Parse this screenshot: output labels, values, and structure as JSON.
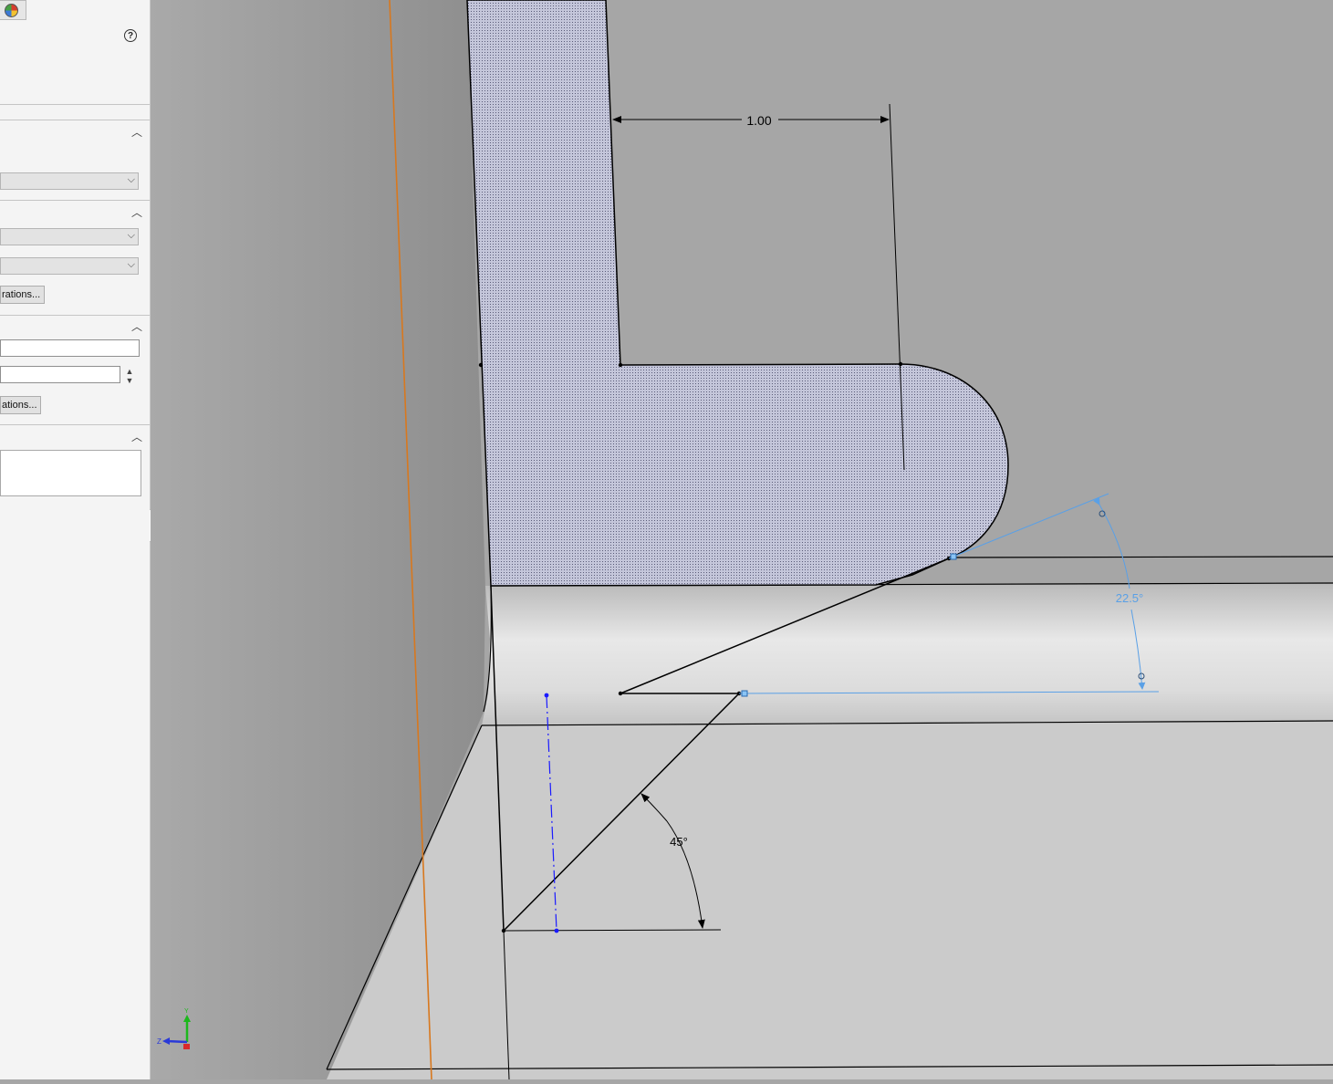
{
  "property_manager": {
    "help_glyph": "?",
    "groups": [
      {
        "collapse_icon": "chevron-up-icon",
        "combo_value": ""
      },
      {
        "collapse_icon": "chevron-up-icon",
        "combo1_value": "",
        "combo2_value": "",
        "button_label": "rations..."
      },
      {
        "collapse_icon": "chevron-up-icon",
        "field1_value": "",
        "field2_value": "",
        "button_label": "ations..."
      },
      {
        "collapse_icon": "chevron-up-icon",
        "list_value": ""
      }
    ],
    "splitter_glyph": "◦"
  },
  "viewport": {
    "dimensions": {
      "horizontal_distance": "1.00",
      "bottom_angle": "45°",
      "driven_angle": "22.5°"
    },
    "triad": {
      "y_axis": "Y",
      "z_axis": "Z"
    },
    "colors": {
      "background": "#a6a6a6",
      "wall_face": "#999999",
      "floor_face": "#cbcbcb",
      "sketch_region": "#b4b6cc",
      "sketch_line": "#000000",
      "driven_dimension": "#5aa0e6",
      "construction_line": "#1a1aff",
      "origin_axis": "#e07a20"
    }
  }
}
